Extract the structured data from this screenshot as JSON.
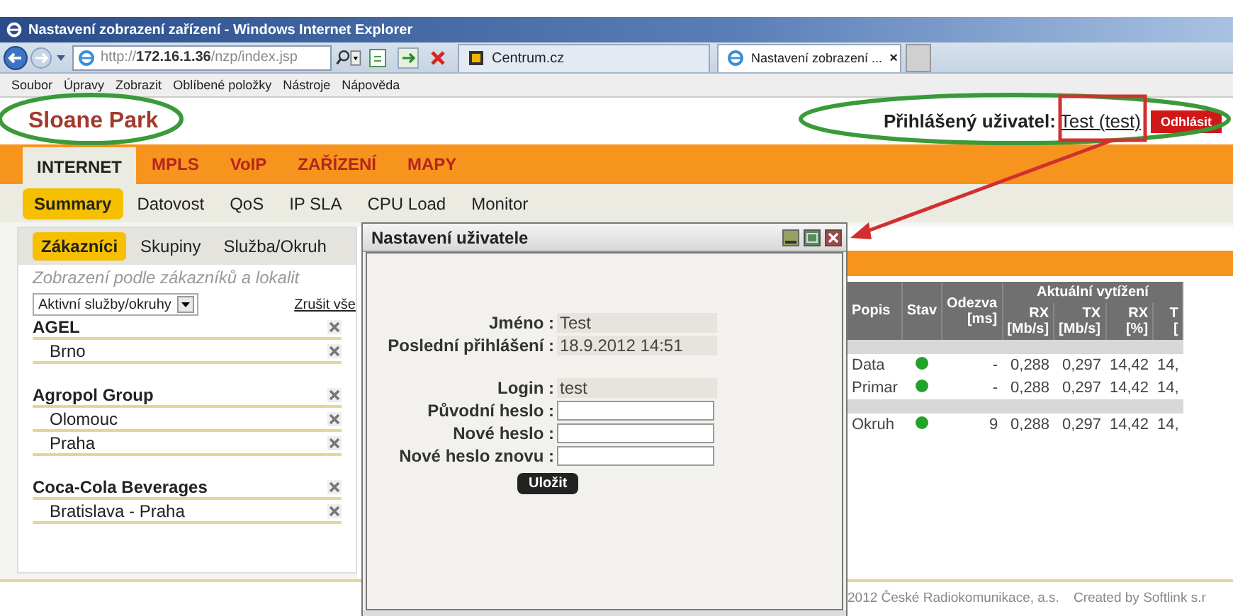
{
  "browser": {
    "title": "Nastavení zobrazení zařízení - Windows Internet Explorer",
    "url": "http://**172.16.1.36**/nzp/index.jsp",
    "tabs": [
      {
        "label": "Centrum.cz",
        "selected": false
      },
      {
        "label": "Nastavení zobrazení ...",
        "selected": true,
        "close": "×"
      }
    ],
    "menu": [
      "Soubor",
      "Úpravy",
      "Zobrazit",
      "Oblíbené položky",
      "Nástroje",
      "Nápověda"
    ]
  },
  "site": {
    "logo": "Sloane Park",
    "user_label": "Přihlášený uživatel:",
    "user_link": "Test (test)",
    "logout": "Odhlásit"
  },
  "nav": [
    {
      "label": "INTERNET",
      "selected": true
    },
    {
      "label": "MPLS",
      "selected": false
    },
    {
      "label": "VoIP",
      "selected": false
    },
    {
      "label": "ZAŘÍZENÍ",
      "selected": false
    },
    {
      "label": "MAPY",
      "selected": false
    }
  ],
  "subnav": [
    {
      "label": "Summary",
      "selected": true
    },
    {
      "label": "Datovost",
      "selected": false
    },
    {
      "label": "QoS",
      "selected": false
    },
    {
      "label": "IP SLA",
      "selected": false
    },
    {
      "label": "CPU Load",
      "selected": false
    },
    {
      "label": "Monitor",
      "selected": false
    }
  ],
  "left_panel": {
    "tabs": [
      {
        "label": "Zákazníci",
        "selected": true
      },
      {
        "label": "Skupiny",
        "selected": false
      },
      {
        "label": "Služba/Okruh",
        "selected": false
      }
    ],
    "hint": "Zobrazení podle zákazníků a lokalit",
    "filter": "Aktivní služby/okruhy",
    "clear": "Zrušit vše",
    "groups": [
      {
        "name": "AGEL",
        "children": [
          {
            "name": "Brno"
          }
        ]
      },
      {
        "name": "Agropol Group",
        "children": [
          {
            "name": "Olomouc"
          },
          {
            "name": "Praha"
          }
        ]
      },
      {
        "name": "Coca-Cola Beverages",
        "children": [
          {
            "name": "Bratislava - Praha"
          }
        ]
      }
    ]
  },
  "dialog": {
    "title": "Nastavení uživatele",
    "info_fields": [
      {
        "label": "Jméno :",
        "value": "Test"
      },
      {
        "label": "Poslední přihlášení :",
        "value": "18.9.2012 14:51"
      }
    ],
    "login_fields": [
      {
        "label": "Login :",
        "value": "test",
        "kind": "readonly"
      },
      {
        "label": "Původní heslo :",
        "kind": "input"
      },
      {
        "label": "Nové heslo :",
        "kind": "input"
      },
      {
        "label": "Nové heslo znovu :",
        "kind": "input"
      }
    ],
    "save": "Uložit"
  },
  "table": {
    "group_header": "Aktuální vytížení",
    "columns": [
      {
        "label": "Popis"
      },
      {
        "label": "Stav"
      },
      {
        "label": "Odezva",
        "unit": "[ms]"
      },
      {
        "label": "RX",
        "unit": "[Mb/s]"
      },
      {
        "label": "TX",
        "unit": "[Mb/s]"
      },
      {
        "label": "RX",
        "unit": "[%]"
      },
      {
        "label": "T",
        "unit": "["
      }
    ],
    "sections": [
      {
        "rows": [
          {
            "popis": "Data",
            "online": true,
            "values": [
              "-",
              "0,288",
              "0,297",
              "14,42",
              "14,"
            ]
          },
          {
            "popis": "Primar",
            "online": true,
            "values": [
              "-",
              "0,288",
              "0,297",
              "14,42",
              "14,"
            ]
          }
        ]
      },
      {
        "rows": [
          {
            "popis": "Okruh",
            "online": true,
            "values": [
              "9",
              "0,288",
              "0,297",
              "14,42",
              "14,"
            ]
          }
        ]
      }
    ]
  },
  "footer": [
    "2012 České Radiokomunikace, a.s.",
    "Created by Softlink s.r"
  ]
}
